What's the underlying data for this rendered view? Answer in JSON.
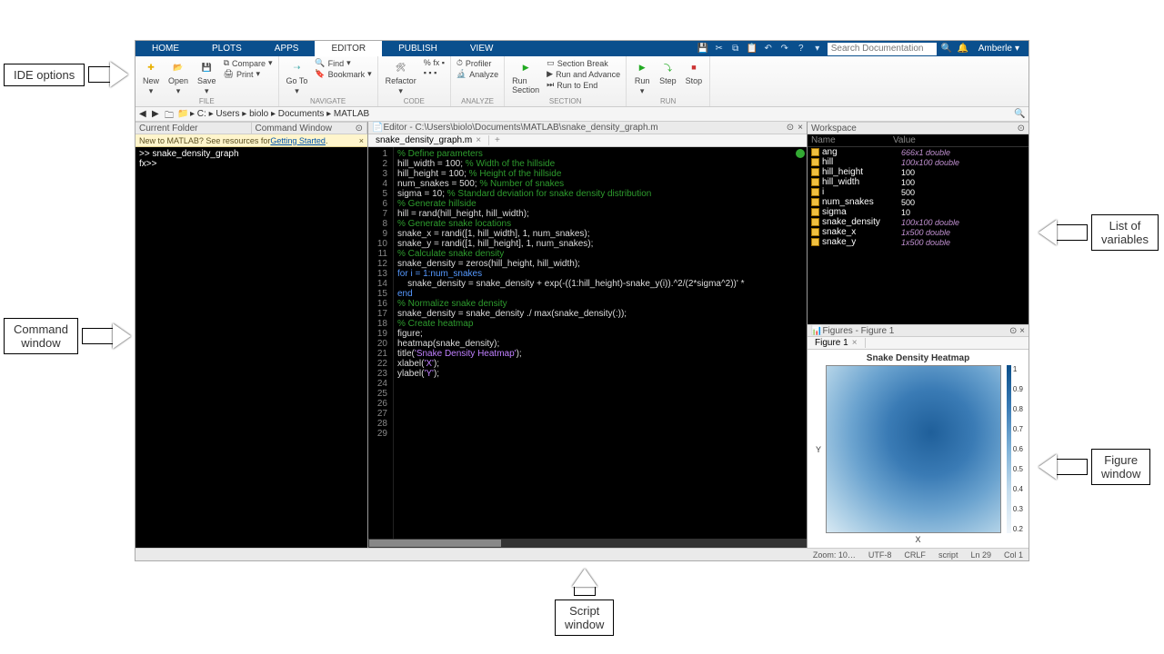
{
  "tabs": [
    "HOME",
    "PLOTS",
    "APPS",
    "EDITOR",
    "PUBLISH",
    "VIEW"
  ],
  "active_tab": "EDITOR",
  "search_placeholder": "Search Documentation",
  "user": "Amberle",
  "ribbon": {
    "file": {
      "new": "New",
      "open": "Open",
      "save": "Save",
      "compare": "Compare",
      "print": "Print",
      "label": "FILE"
    },
    "nav": {
      "goto": "Go To",
      "find": "Find",
      "bookmark": "Bookmark",
      "label": "NAVIGATE"
    },
    "code": {
      "refactor": "Refactor",
      "label": "CODE"
    },
    "analyze": {
      "profiler": "Profiler",
      "analyze": "Analyze",
      "label": "ANALYZE"
    },
    "section": {
      "run": "Run\nSection",
      "break": "Section Break",
      "adv": "Run and Advance",
      "end": "Run to End",
      "label": "SECTION"
    },
    "run": {
      "run": "Run",
      "step": "Step",
      "stop": "Stop",
      "label": "RUN"
    }
  },
  "path": [
    "C:",
    "Users",
    "biolo",
    "Documents",
    "MATLAB"
  ],
  "left_panels": {
    "folder": "Current Folder",
    "cmd": "Command Window"
  },
  "getting_started": {
    "pre": "New to MATLAB? See resources for ",
    "link": "Getting Started",
    "post": "."
  },
  "cmd_lines": [
    ">> snake_density_graph",
    "fx>>"
  ],
  "editor_title": "Editor - C:\\Users\\biolo\\Documents\\MATLAB\\snake_density_graph.m",
  "editor_tab": "snake_density_graph.m",
  "code": [
    {
      "n": 1,
      "t": "% Define parameters",
      "cls": "c-cm"
    },
    {
      "n": 2,
      "t": "hill_width = 100; ",
      "trail": "% Width of the hillside"
    },
    {
      "n": 3,
      "t": "hill_height = 100; ",
      "trail": "% Height of the hillside"
    },
    {
      "n": 4,
      "t": "num_snakes = 500; ",
      "trail": "% Number of snakes"
    },
    {
      "n": 5,
      "t": "sigma = 10; ",
      "trail": "% Standard deviation for snake density distribution"
    },
    {
      "n": 6,
      "t": ""
    },
    {
      "n": 7,
      "t": "% Generate hillside",
      "cls": "c-cm"
    },
    {
      "n": 8,
      "t": "hill = rand(hill_height, hill_width);"
    },
    {
      "n": 9,
      "t": ""
    },
    {
      "n": 10,
      "t": "% Generate snake locations",
      "cls": "c-cm"
    },
    {
      "n": 11,
      "t": "snake_x = randi([1, hill_width], 1, num_snakes);"
    },
    {
      "n": 12,
      "t": "snake_y = randi([1, hill_height], 1, num_snakes);"
    },
    {
      "n": 13,
      "t": ""
    },
    {
      "n": 14,
      "t": "% Calculate snake density",
      "cls": "c-cm"
    },
    {
      "n": 15,
      "t": "snake_density = zeros(hill_height, hill_width);"
    },
    {
      "n": 16,
      "t": "for i = 1:num_snakes",
      "kw": "for"
    },
    {
      "n": 17,
      "t": "    snake_density = snake_density + exp(-((1:hill_height)-snake_y(i)).^2/(2*sigma^2))' *"
    },
    {
      "n": 18,
      "t": "end",
      "kw": "end"
    },
    {
      "n": 19,
      "t": ""
    },
    {
      "n": 20,
      "t": "% Normalize snake density",
      "cls": "c-cm"
    },
    {
      "n": 21,
      "t": "snake_density = snake_density ./ max(snake_density(:));"
    },
    {
      "n": 22,
      "t": ""
    },
    {
      "n": 23,
      "t": "% Create heatmap",
      "cls": "c-cm"
    },
    {
      "n": 24,
      "t": "figure;"
    },
    {
      "n": 25,
      "t": "heatmap(snake_density);"
    },
    {
      "n": 26,
      "t": "title(",
      "str": "'Snake Density Heatmap'",
      "post": ");"
    },
    {
      "n": 27,
      "t": "xlabel(",
      "str": "'X'",
      "post": ");"
    },
    {
      "n": 28,
      "t": "ylabel(",
      "str": "'Y'",
      "post": ");"
    },
    {
      "n": 29,
      "t": ""
    }
  ],
  "workspace_title": "Workspace",
  "ws_cols": {
    "name": "Name",
    "value": "Value"
  },
  "ws": [
    {
      "n": "ang",
      "v": "666x1 double",
      "i": true
    },
    {
      "n": "hill",
      "v": "100x100 double",
      "i": true
    },
    {
      "n": "hill_height",
      "v": "100"
    },
    {
      "n": "hill_width",
      "v": "100"
    },
    {
      "n": "i",
      "v": "500"
    },
    {
      "n": "num_snakes",
      "v": "500"
    },
    {
      "n": "sigma",
      "v": "10"
    },
    {
      "n": "snake_density",
      "v": "100x100 double",
      "i": true
    },
    {
      "n": "snake_x",
      "v": "1x500 double",
      "i": true
    },
    {
      "n": "snake_y",
      "v": "1x500 double",
      "i": true
    }
  ],
  "figures_title": "Figures - Figure 1",
  "figure_tab": "Figure 1",
  "chart_data": {
    "type": "heatmap",
    "title": "Snake Density Heatmap",
    "xlabel": "X",
    "ylabel": "Y",
    "xlim": [
      1,
      100
    ],
    "ylim": [
      1,
      100
    ],
    "colorbar_ticks": [
      0.2,
      0.3,
      0.4,
      0.5,
      0.6,
      0.7,
      0.8,
      0.9,
      1
    ]
  },
  "status": {
    "zoom": "Zoom: 10…",
    "enc": "UTF-8",
    "eol": "CRLF",
    "type": "script",
    "ln": "Ln  29",
    "col": "Col  1"
  },
  "callouts": {
    "ide": "IDE options",
    "cmd": "Command\nwindow",
    "vars": "List of\nvariables",
    "fig": "Figure\nwindow",
    "script": "Script\nwindow"
  }
}
